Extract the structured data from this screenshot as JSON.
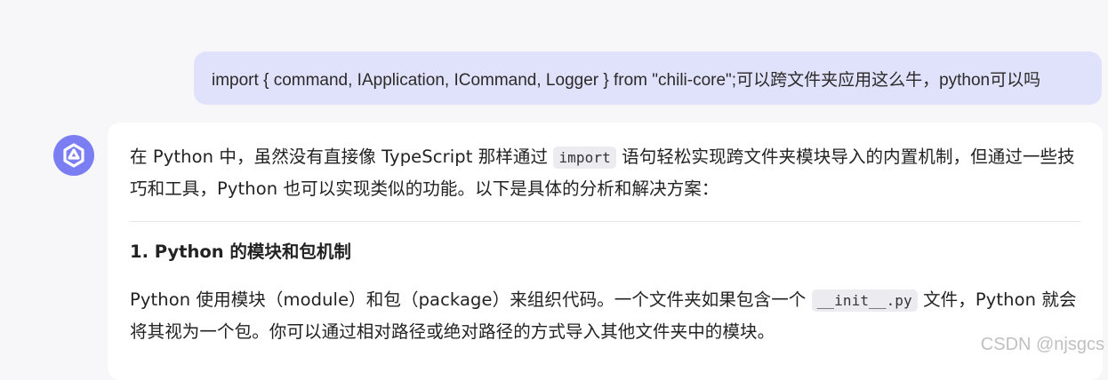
{
  "user_message": {
    "text": "import { command, IApplication, ICommand, Logger } from \"chili-core\";可以跨文件夹应用这么牛，python可以吗"
  },
  "assistant": {
    "avatar_icon": "sparkle-logo-icon",
    "avatar_color": "#7b7ef3",
    "intro": {
      "part1": "在 Python 中，虽然没有直接像 TypeScript 那样通过 ",
      "code": "import",
      "part2": " 语句轻松实现跨文件夹模块导入的内置机制，但通过一些技巧和工具，Python 也可以实现类似的功能。以下是具体的分析和解决方案："
    },
    "section1": {
      "heading": "1. Python 的模块和包机制",
      "part1": "Python 使用模块（module）和包（package）来组织代码。一个文件夹如果包含一个 ",
      "code": "__init__.py",
      "part2": " 文件，Python 就会将其视为一个包。你可以通过相对路径或绝对路径的方式导入其他文件夹中的模块。"
    }
  },
  "watermark": "CSDN @njsgcs",
  "colors": {
    "user_bubble_bg": "#e0e2fb",
    "page_bg": "#f7f7fa",
    "card_bg": "#ffffff"
  }
}
